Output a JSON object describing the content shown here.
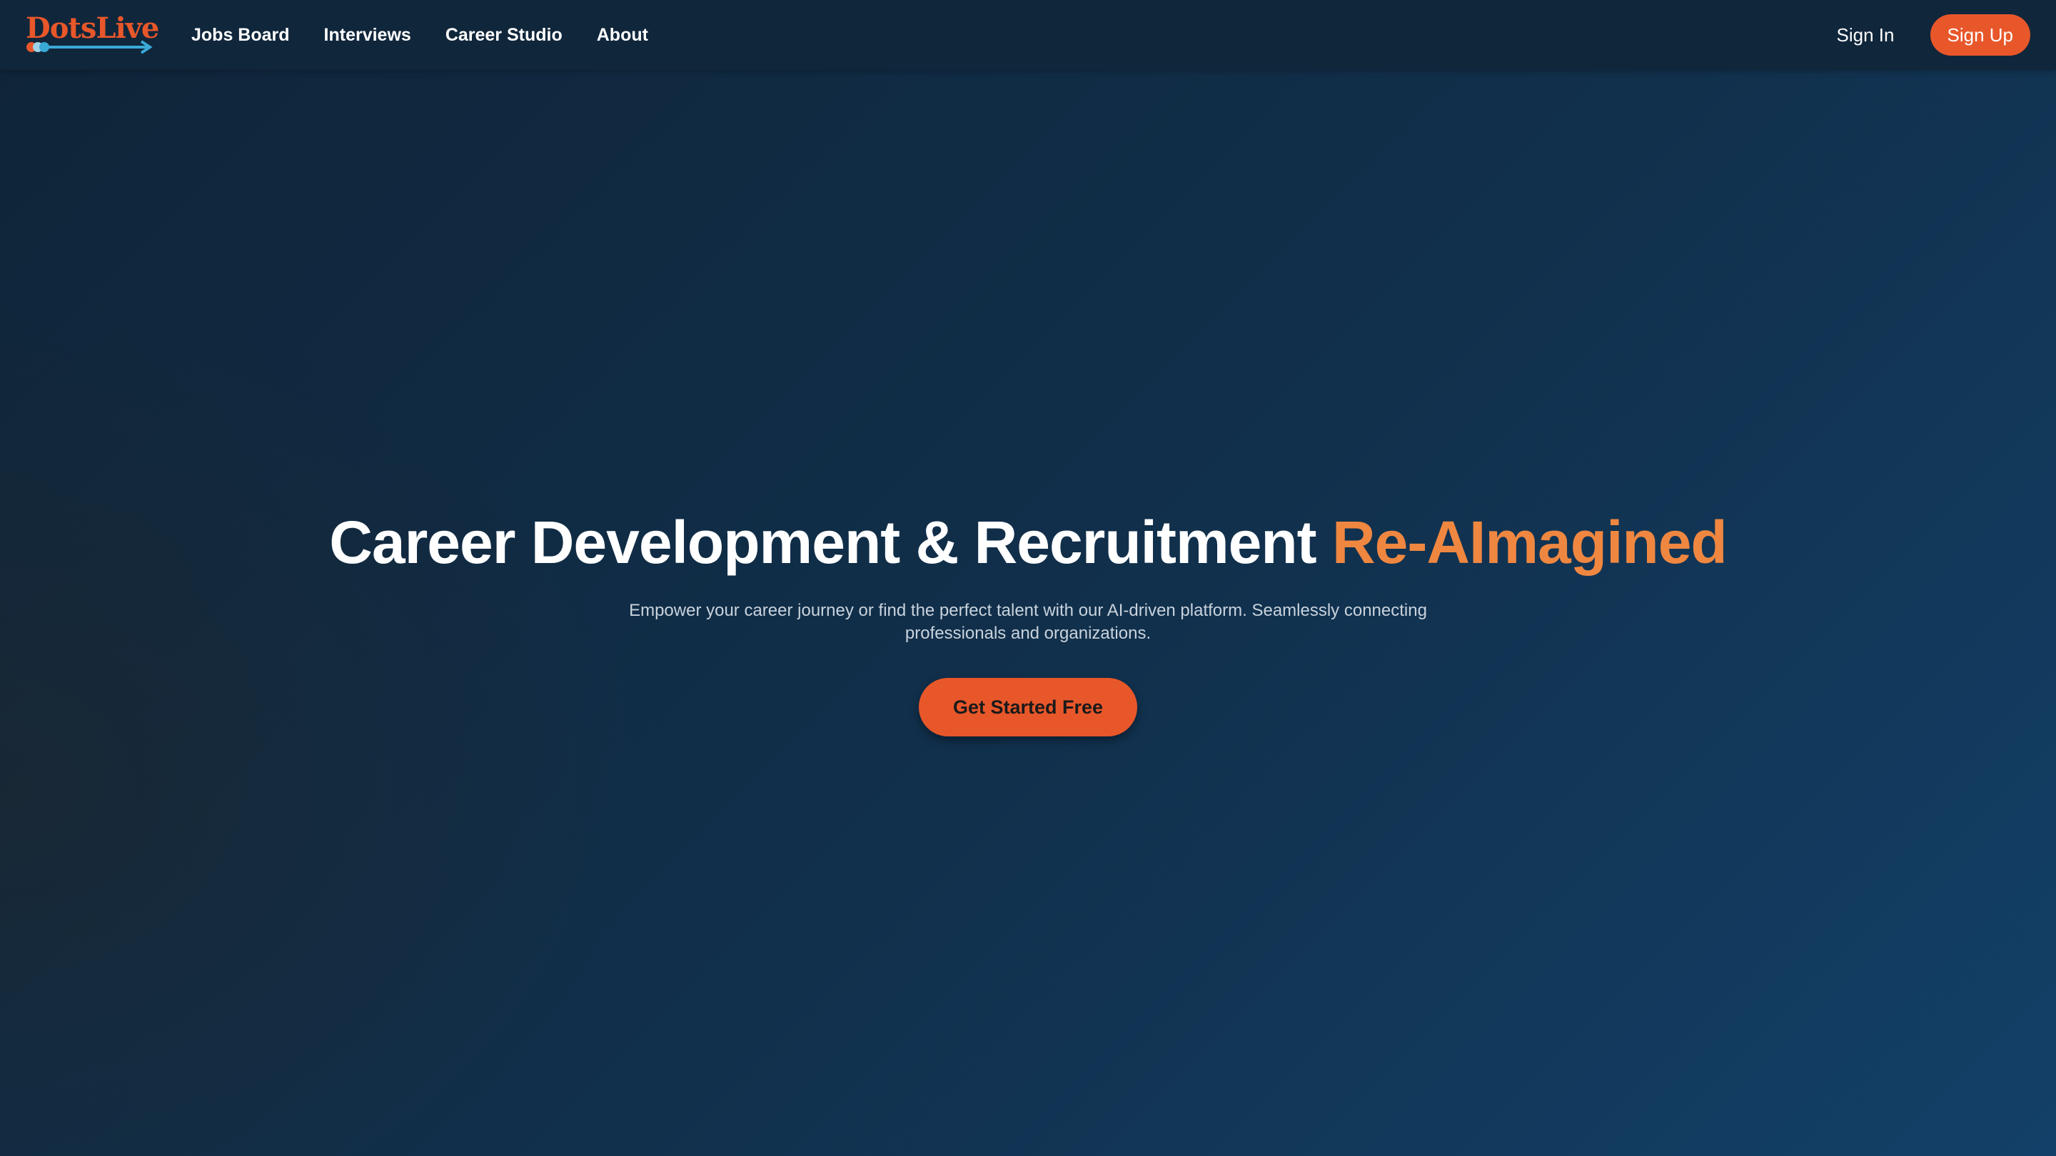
{
  "brand": {
    "name": "DotsLive",
    "color": "#e8572a",
    "accent_blue": "#3aa9d8"
  },
  "nav": {
    "links": [
      {
        "label": "Jobs Board"
      },
      {
        "label": "Interviews"
      },
      {
        "label": "Career Studio"
      },
      {
        "label": "About"
      }
    ],
    "sign_in": "Sign In",
    "sign_up": "Sign Up"
  },
  "hero": {
    "title_main": "Career Development & Recruitment ",
    "title_accent": "Re-AImagined",
    "subtitle": "Empower your career journey or find the perfect talent with our AI-driven platform. Seamlessly connecting professionals and organizations.",
    "cta_label": "Get Started Free"
  },
  "colors": {
    "background": "#11304c",
    "navbar": "#10263b",
    "primary": "#e8572a",
    "accent_text": "#ef8741"
  }
}
